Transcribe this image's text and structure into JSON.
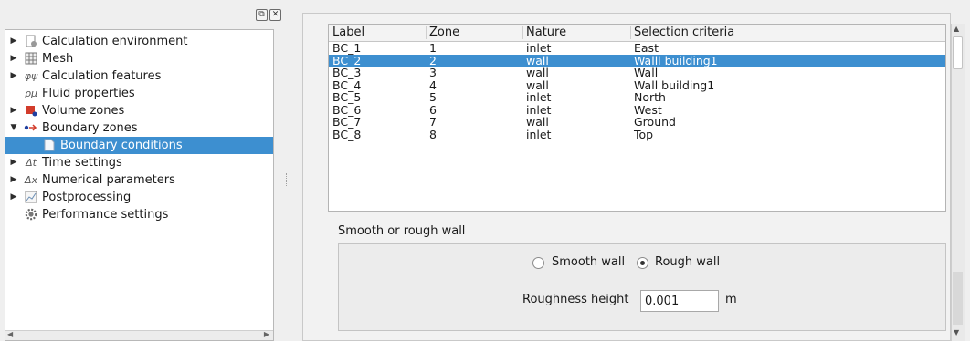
{
  "dock": {
    "float_button": "⧉",
    "close_button": "✕"
  },
  "tree": {
    "items": [
      {
        "label": "Calculation environment",
        "icon": "page-gear-icon",
        "has_children": true,
        "expanded": false,
        "indent": 0
      },
      {
        "label": "Mesh",
        "icon": "grid-icon",
        "has_children": true,
        "expanded": false,
        "indent": 0
      },
      {
        "label": "Calculation features",
        "icon": "formula-icon",
        "icon_glyph": "φψ",
        "has_children": true,
        "expanded": false,
        "indent": 0
      },
      {
        "label": "Fluid properties",
        "icon": "rho-mu-icon",
        "icon_glyph": "ρμ",
        "has_children": false,
        "expanded": false,
        "indent": 0
      },
      {
        "label": "Volume zones",
        "icon": "volume-zones-icon",
        "has_children": true,
        "expanded": false,
        "indent": 0
      },
      {
        "label": "Boundary zones",
        "icon": "boundary-zones-icon",
        "has_children": true,
        "expanded": true,
        "indent": 0
      },
      {
        "label": "Boundary conditions",
        "icon": "page-icon",
        "has_children": false,
        "expanded": false,
        "indent": 1,
        "selected": true
      },
      {
        "label": "Time settings",
        "icon": "delta-t-icon",
        "icon_glyph": "Δt",
        "has_children": true,
        "expanded": false,
        "indent": 0
      },
      {
        "label": "Numerical parameters",
        "icon": "delta-x-icon",
        "icon_glyph": "Δx",
        "has_children": true,
        "expanded": false,
        "indent": 0
      },
      {
        "label": "Postprocessing",
        "icon": "chart-icon",
        "has_children": true,
        "expanded": false,
        "indent": 0
      },
      {
        "label": "Performance settings",
        "icon": "gear-icon",
        "has_children": false,
        "expanded": false,
        "indent": 0
      }
    ]
  },
  "table": {
    "columns": [
      "Label",
      "Zone",
      "Nature",
      "Selection criteria"
    ],
    "rows": [
      [
        "BC_1",
        "1",
        "inlet",
        "East"
      ],
      [
        "BC_2",
        "2",
        "wall",
        "Walll building1"
      ],
      [
        "BC_3",
        "3",
        "wall",
        "Wall"
      ],
      [
        "BC_4",
        "4",
        "wall",
        "Wall building1"
      ],
      [
        "BC_5",
        "5",
        "inlet",
        "North"
      ],
      [
        "BC_6",
        "6",
        "inlet",
        "West"
      ],
      [
        "BC_7",
        "7",
        "wall",
        "Ground"
      ],
      [
        "BC_8",
        "8",
        "inlet",
        "Top"
      ]
    ],
    "selected_row": 1
  },
  "wall_group": {
    "title": "Smooth or rough wall",
    "smooth_label": "Smooth wall",
    "rough_label": "Rough wall",
    "selected": "rough",
    "roughness_label": "Roughness height",
    "roughness_value": "0.001",
    "roughness_unit": "m"
  },
  "colors": {
    "selection": "#3d8fd0",
    "background": "#efefef"
  }
}
